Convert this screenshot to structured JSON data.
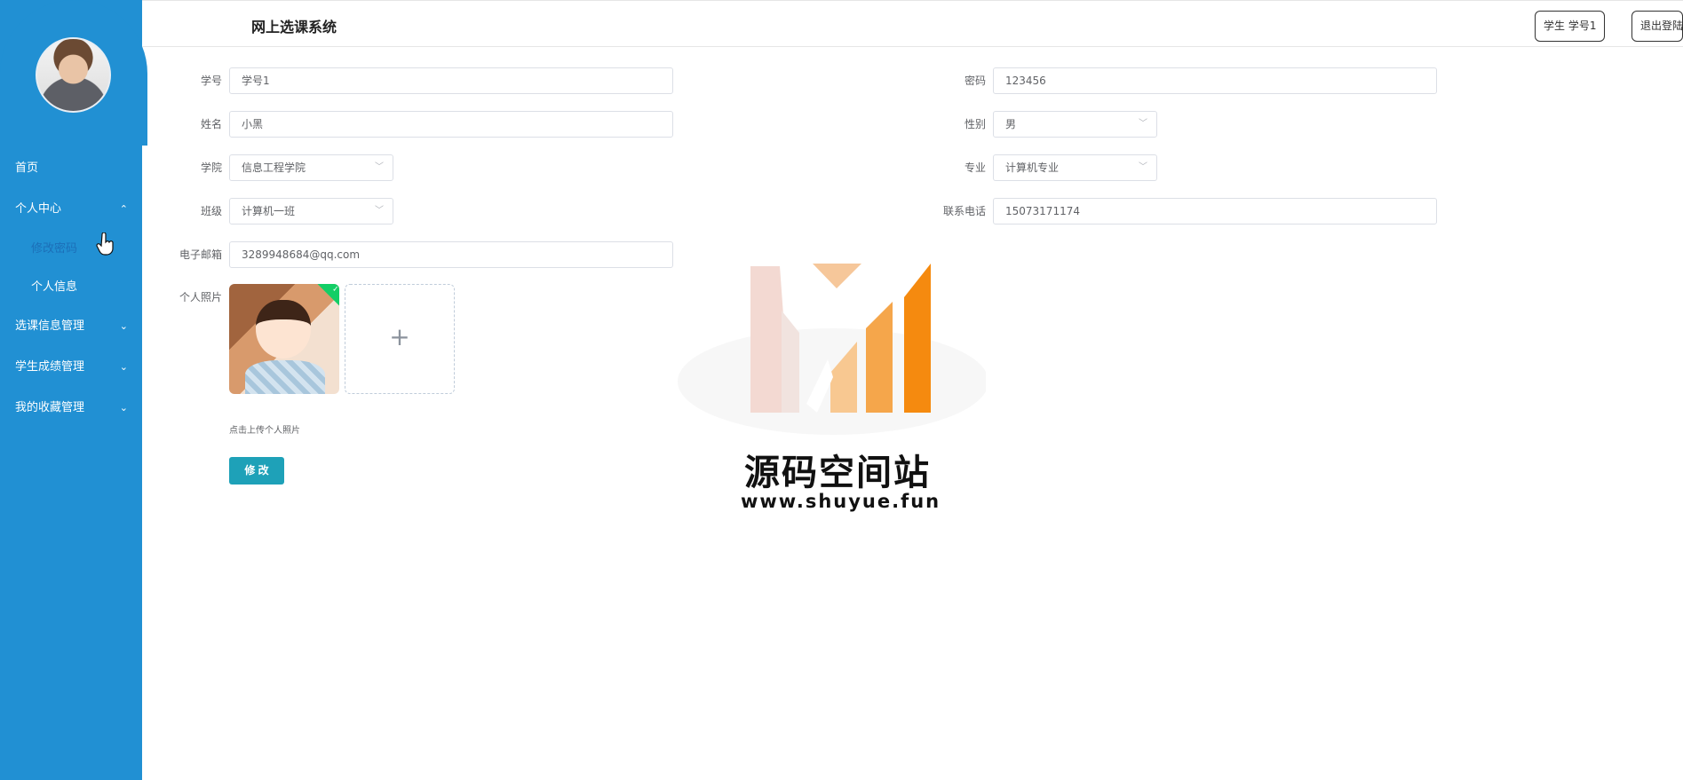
{
  "header": {
    "title": "网上选课系统",
    "user_button": "学生 学号1",
    "logout_button": "退出登陆"
  },
  "sidebar": {
    "items": [
      {
        "label": "首页",
        "arrow": ""
      },
      {
        "label": "个人中心",
        "arrow": "⌃"
      },
      {
        "label": "修改密码",
        "arrow": ""
      },
      {
        "label": "个人信息",
        "arrow": ""
      },
      {
        "label": "选课信息管理",
        "arrow": "⌄"
      },
      {
        "label": "学生成绩管理",
        "arrow": "⌄"
      },
      {
        "label": "我的收藏管理",
        "arrow": "⌄"
      }
    ]
  },
  "form": {
    "student_id_label": "学号",
    "student_id_value": "学号1",
    "password_label": "密码",
    "password_value": "123456",
    "name_label": "姓名",
    "name_value": "小黑",
    "gender_label": "性别",
    "gender_value": "男",
    "college_label": "学院",
    "college_value": "信息工程学院",
    "major_label": "专业",
    "major_value": "计算机专业",
    "class_label": "班级",
    "class_value": "计算机一班",
    "phone_label": "联系电话",
    "phone_value": "15073171174",
    "email_label": "电子邮箱",
    "email_value": "3289948684@qq.com",
    "photo_label": "个人照片",
    "upload_plus": "+",
    "upload_hint": "点击上传个人照片",
    "submit_label": "修 改"
  },
  "watermark": {
    "text": "源码空间站",
    "url": "www.shuyue.fun"
  },
  "colors": {
    "sidebar": "#2190d3",
    "submit_button": "#1ea1b8",
    "active_submenu": "#1c6fb8",
    "upload_success": "#13ce66"
  },
  "icons": {
    "chevron_up": "chevron-up-icon",
    "chevron_down": "chevron-down-icon",
    "select_caret": "chevron-down-icon",
    "check": "check-icon",
    "plus": "plus-icon"
  }
}
